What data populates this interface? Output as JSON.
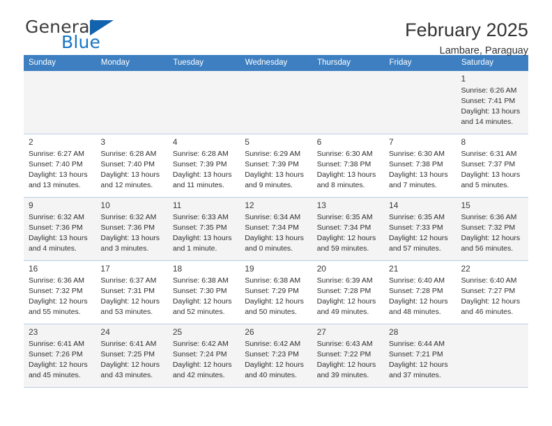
{
  "brand": {
    "word_one": "General",
    "word_two": "Blue",
    "accent_color": "#1775c4",
    "triangle_color": "#1163ad",
    "triangle_icon": "triangle-icon"
  },
  "header": {
    "title": "February 2025",
    "subtitle": "Lambare, Paraguay",
    "header_bg": "#3d7fc1"
  },
  "calendar": {
    "weekdays": [
      "Sunday",
      "Monday",
      "Tuesday",
      "Wednesday",
      "Thursday",
      "Friday",
      "Saturday"
    ],
    "weeks": [
      [
        {
          "day": "",
          "info": "",
          "empty": true
        },
        {
          "day": "",
          "info": "",
          "empty": true
        },
        {
          "day": "",
          "info": "",
          "empty": true
        },
        {
          "day": "",
          "info": "",
          "empty": true
        },
        {
          "day": "",
          "info": "",
          "empty": true
        },
        {
          "day": "",
          "info": "",
          "empty": true
        },
        {
          "day": "1",
          "info": "Sunrise: 6:26 AM\nSunset: 7:41 PM\nDaylight: 13 hours\nand 14 minutes."
        }
      ],
      [
        {
          "day": "2",
          "info": "Sunrise: 6:27 AM\nSunset: 7:40 PM\nDaylight: 13 hours\nand 13 minutes."
        },
        {
          "day": "3",
          "info": "Sunrise: 6:28 AM\nSunset: 7:40 PM\nDaylight: 13 hours\nand 12 minutes."
        },
        {
          "day": "4",
          "info": "Sunrise: 6:28 AM\nSunset: 7:39 PM\nDaylight: 13 hours\nand 11 minutes."
        },
        {
          "day": "5",
          "info": "Sunrise: 6:29 AM\nSunset: 7:39 PM\nDaylight: 13 hours\nand 9 minutes."
        },
        {
          "day": "6",
          "info": "Sunrise: 6:30 AM\nSunset: 7:38 PM\nDaylight: 13 hours\nand 8 minutes."
        },
        {
          "day": "7",
          "info": "Sunrise: 6:30 AM\nSunset: 7:38 PM\nDaylight: 13 hours\nand 7 minutes."
        },
        {
          "day": "8",
          "info": "Sunrise: 6:31 AM\nSunset: 7:37 PM\nDaylight: 13 hours\nand 5 minutes."
        }
      ],
      [
        {
          "day": "9",
          "info": "Sunrise: 6:32 AM\nSunset: 7:36 PM\nDaylight: 13 hours\nand 4 minutes."
        },
        {
          "day": "10",
          "info": "Sunrise: 6:32 AM\nSunset: 7:36 PM\nDaylight: 13 hours\nand 3 minutes."
        },
        {
          "day": "11",
          "info": "Sunrise: 6:33 AM\nSunset: 7:35 PM\nDaylight: 13 hours\nand 1 minute."
        },
        {
          "day": "12",
          "info": "Sunrise: 6:34 AM\nSunset: 7:34 PM\nDaylight: 13 hours\nand 0 minutes."
        },
        {
          "day": "13",
          "info": "Sunrise: 6:35 AM\nSunset: 7:34 PM\nDaylight: 12 hours\nand 59 minutes."
        },
        {
          "day": "14",
          "info": "Sunrise: 6:35 AM\nSunset: 7:33 PM\nDaylight: 12 hours\nand 57 minutes."
        },
        {
          "day": "15",
          "info": "Sunrise: 6:36 AM\nSunset: 7:32 PM\nDaylight: 12 hours\nand 56 minutes."
        }
      ],
      [
        {
          "day": "16",
          "info": "Sunrise: 6:36 AM\nSunset: 7:32 PM\nDaylight: 12 hours\nand 55 minutes."
        },
        {
          "day": "17",
          "info": "Sunrise: 6:37 AM\nSunset: 7:31 PM\nDaylight: 12 hours\nand 53 minutes."
        },
        {
          "day": "18",
          "info": "Sunrise: 6:38 AM\nSunset: 7:30 PM\nDaylight: 12 hours\nand 52 minutes."
        },
        {
          "day": "19",
          "info": "Sunrise: 6:38 AM\nSunset: 7:29 PM\nDaylight: 12 hours\nand 50 minutes."
        },
        {
          "day": "20",
          "info": "Sunrise: 6:39 AM\nSunset: 7:28 PM\nDaylight: 12 hours\nand 49 minutes."
        },
        {
          "day": "21",
          "info": "Sunrise: 6:40 AM\nSunset: 7:28 PM\nDaylight: 12 hours\nand 48 minutes."
        },
        {
          "day": "22",
          "info": "Sunrise: 6:40 AM\nSunset: 7:27 PM\nDaylight: 12 hours\nand 46 minutes."
        }
      ],
      [
        {
          "day": "23",
          "info": "Sunrise: 6:41 AM\nSunset: 7:26 PM\nDaylight: 12 hours\nand 45 minutes."
        },
        {
          "day": "24",
          "info": "Sunrise: 6:41 AM\nSunset: 7:25 PM\nDaylight: 12 hours\nand 43 minutes."
        },
        {
          "day": "25",
          "info": "Sunrise: 6:42 AM\nSunset: 7:24 PM\nDaylight: 12 hours\nand 42 minutes."
        },
        {
          "day": "26",
          "info": "Sunrise: 6:42 AM\nSunset: 7:23 PM\nDaylight: 12 hours\nand 40 minutes."
        },
        {
          "day": "27",
          "info": "Sunrise: 6:43 AM\nSunset: 7:22 PM\nDaylight: 12 hours\nand 39 minutes."
        },
        {
          "day": "28",
          "info": "Sunrise: 6:44 AM\nSunset: 7:21 PM\nDaylight: 12 hours\nand 37 minutes."
        },
        {
          "day": "",
          "info": "",
          "empty": true
        }
      ]
    ]
  }
}
